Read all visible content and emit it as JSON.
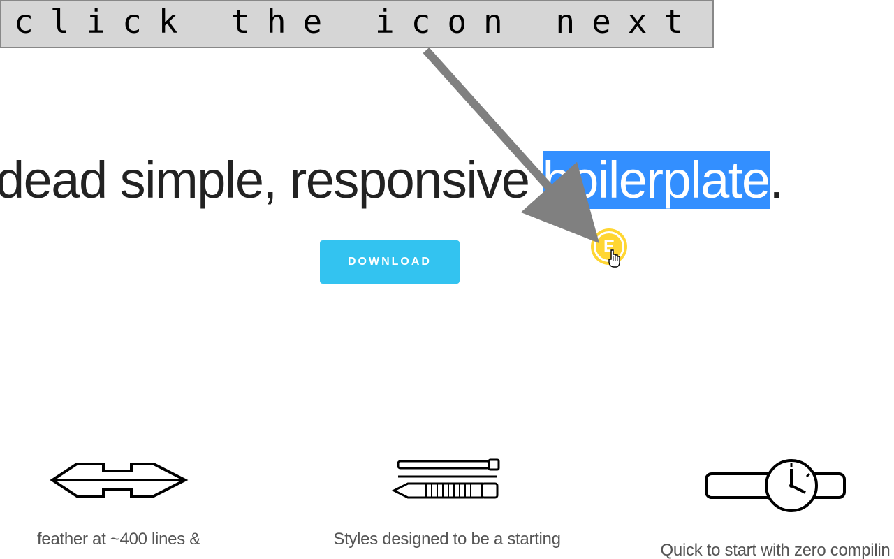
{
  "instruction": "click the icon next",
  "hero": {
    "prefix": " dead simple, responsive ",
    "highlight": "boilerplate",
    "suffix": "."
  },
  "button": {
    "download": "DOWNLOAD"
  },
  "badge": {
    "letter": "E"
  },
  "features": [
    {
      "text": "feather at ~400 lines &"
    },
    {
      "text": "Styles designed to be a starting"
    },
    {
      "text": "Quick to start with zero compilin"
    }
  ]
}
